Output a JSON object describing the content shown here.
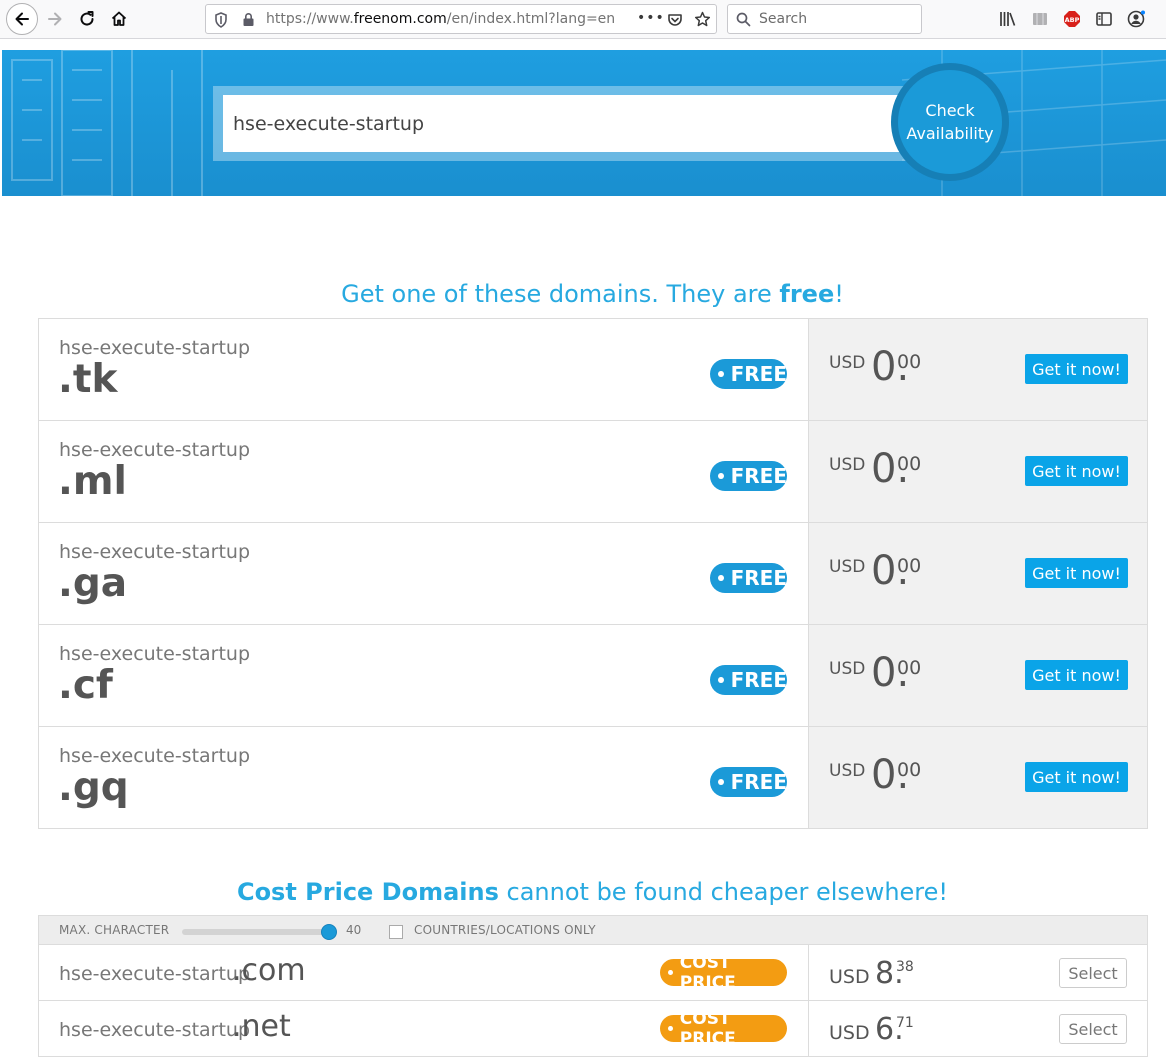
{
  "browser": {
    "url_prefix": "https://www.",
    "url_domain": "freenom.com",
    "url_path": "/en/index.html?lang=en",
    "search_placeholder": "Search",
    "more_label": "•••"
  },
  "hero": {
    "search_value": "hse-execute-startup",
    "check_label_line1": "Check",
    "check_label_line2": "Availability"
  },
  "free_section": {
    "heading_prefix": "Get one of these domains. They are ",
    "heading_bold": "free",
    "heading_suffix": "!",
    "rows": [
      {
        "name": "hse-execute-startup",
        "tld": ".tk",
        "badge": "FREE",
        "currency": "USD",
        "int": "0.",
        "dec": "00",
        "button": "Get it now!"
      },
      {
        "name": "hse-execute-startup",
        "tld": ".ml",
        "badge": "FREE",
        "currency": "USD",
        "int": "0.",
        "dec": "00",
        "button": "Get it now!"
      },
      {
        "name": "hse-execute-startup",
        "tld": ".ga",
        "badge": "FREE",
        "currency": "USD",
        "int": "0.",
        "dec": "00",
        "button": "Get it now!"
      },
      {
        "name": "hse-execute-startup",
        "tld": ".cf",
        "badge": "FREE",
        "currency": "USD",
        "int": "0.",
        "dec": "00",
        "button": "Get it now!"
      },
      {
        "name": "hse-execute-startup",
        "tld": ".gq",
        "badge": "FREE",
        "currency": "USD",
        "int": "0.",
        "dec": "00",
        "button": "Get it now!"
      }
    ]
  },
  "cost_section": {
    "heading_bold": "Cost Price Domains",
    "heading_rest": " cannot be found cheaper elsewhere!",
    "filter": {
      "max_char_label": "MAX. CHARACTER",
      "slider_value": "40",
      "countries_label": "COUNTRIES/LOCATIONS ONLY"
    },
    "rows": [
      {
        "name": "hse-execute-startup",
        "tld": ".com",
        "badge": "COST PRICE",
        "currency": "USD",
        "int": "8.",
        "dec": "38",
        "button": "Select"
      },
      {
        "name": "hse-execute-startup",
        "tld": ".net",
        "badge": "COST PRICE",
        "currency": "USD",
        "int": "6.",
        "dec": "71",
        "button": "Select"
      }
    ]
  }
}
